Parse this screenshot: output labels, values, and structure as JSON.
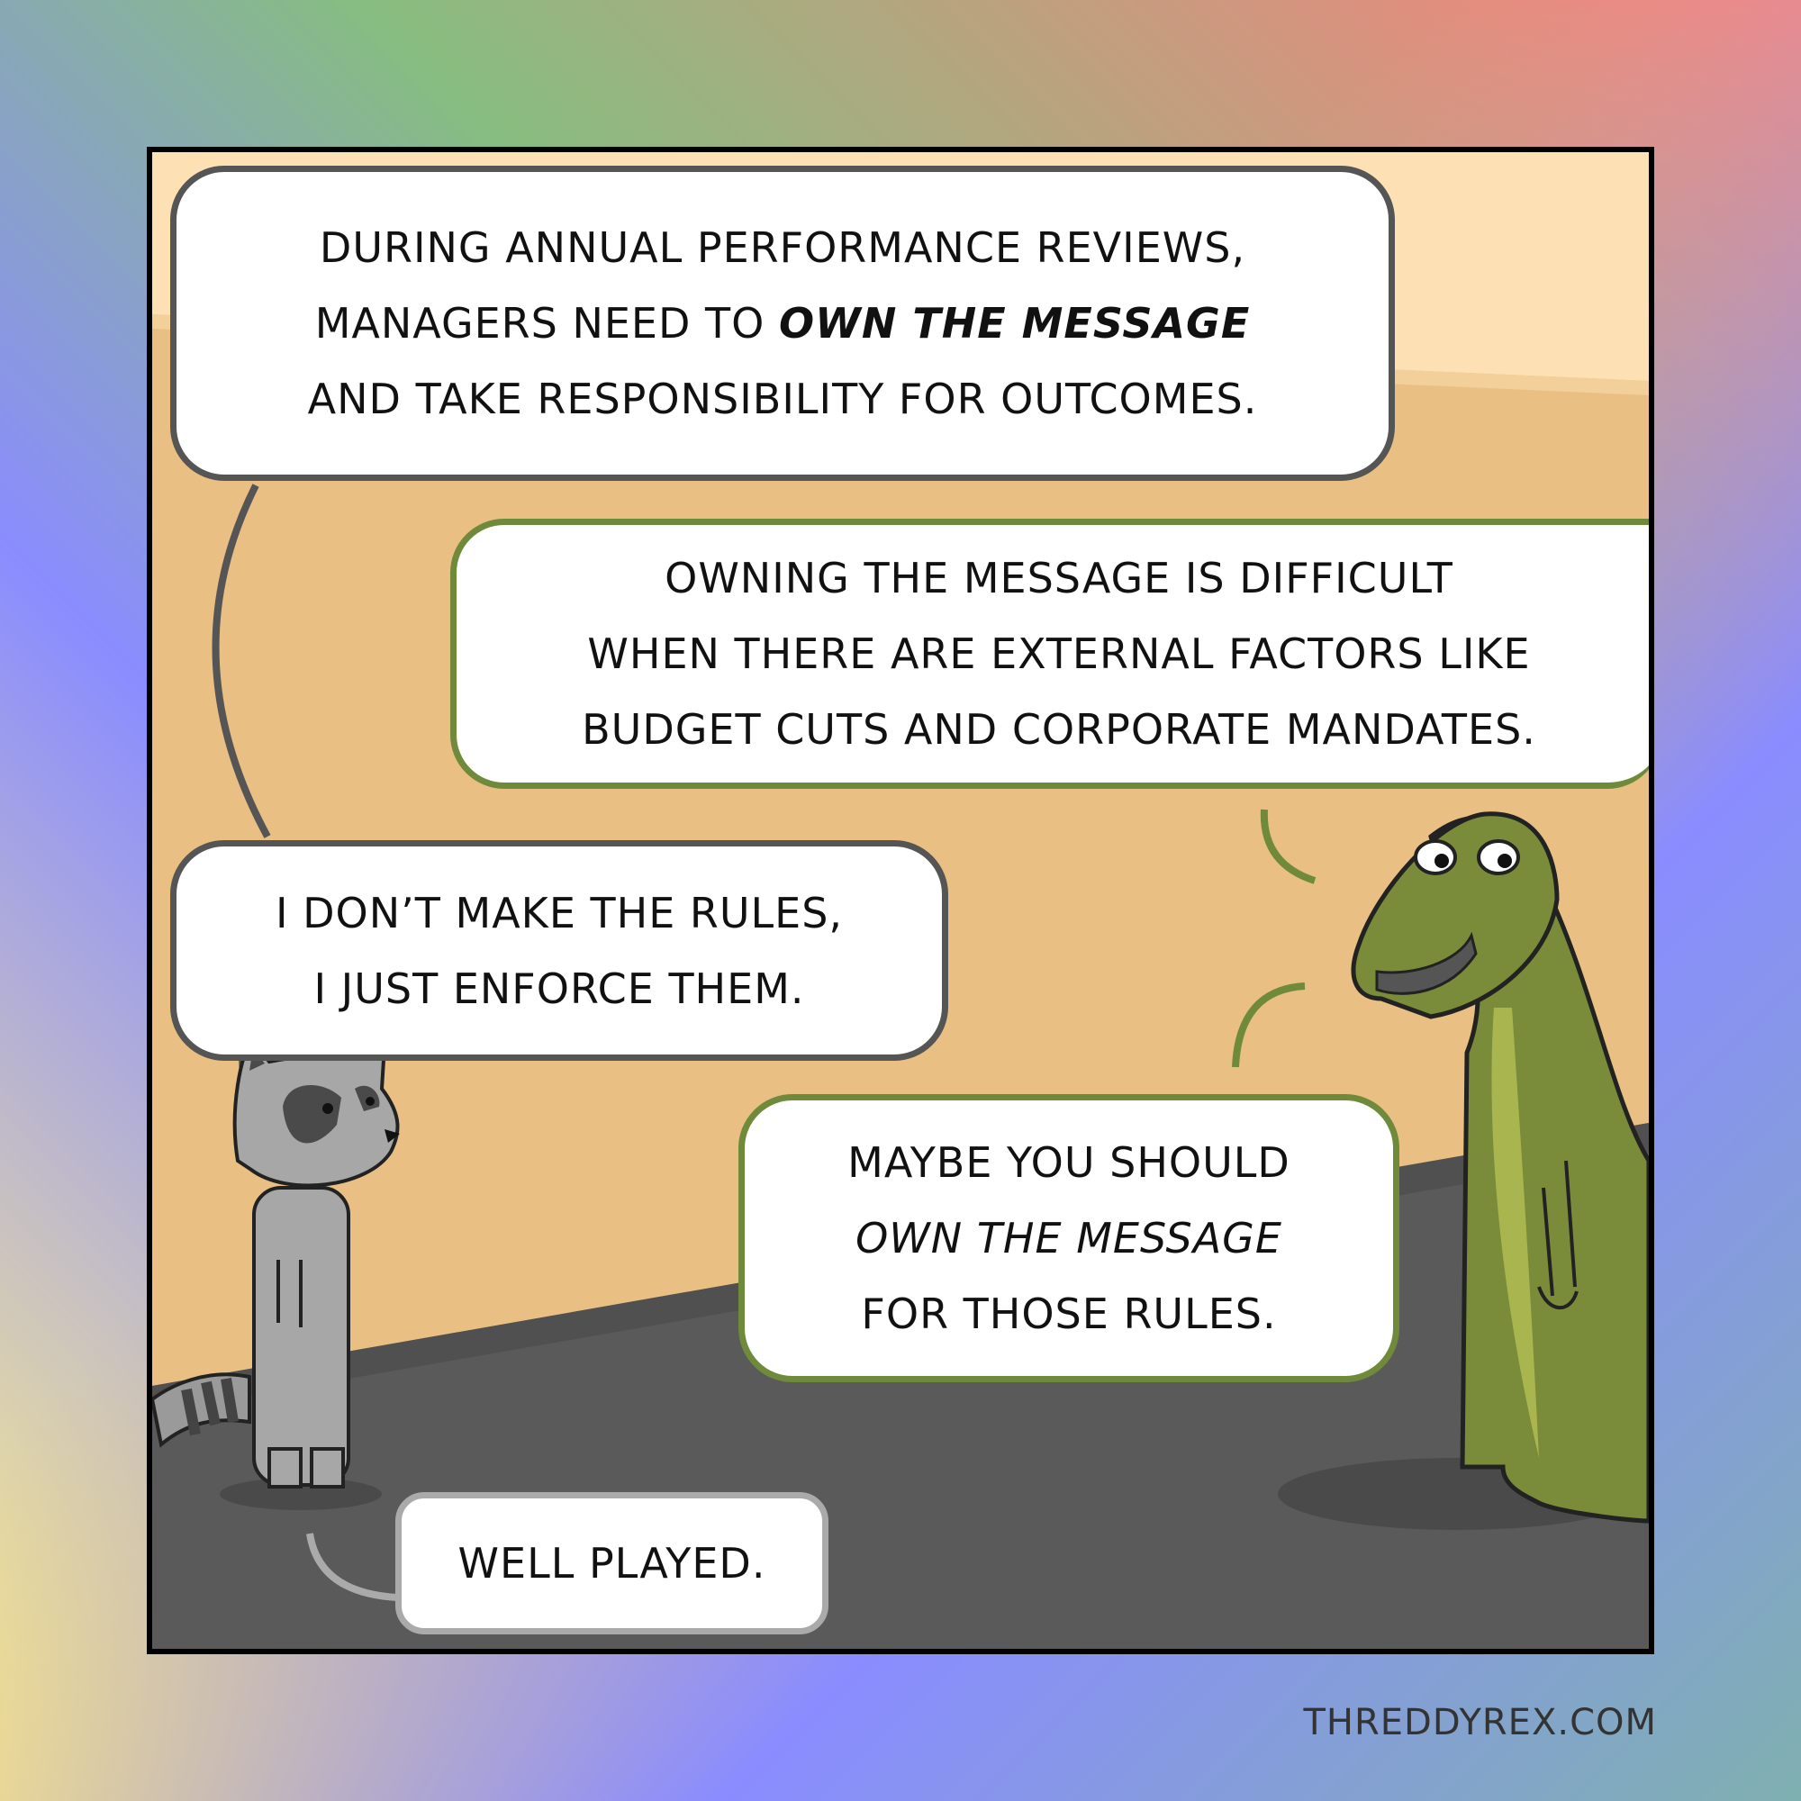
{
  "comic": {
    "bubbles": {
      "manager_line1": "DURING ANNUAL PERFORMANCE REVIEWS,",
      "manager_line2_a": "MANAGERS NEED TO ",
      "manager_line2_b": "OWN THE MESSAGE",
      "manager_line3": "AND TAKE RESPONSIBILITY FOR OUTCOMES.",
      "dino_line1": "OWNING THE MESSAGE IS DIFFICULT",
      "dino_line2": "WHEN THERE ARE EXTERNAL FACTORS LIKE",
      "dino_line3": "BUDGET CUTS AND CORPORATE MANDATES.",
      "raccoon_line1": "I DON’T MAKE THE RULES,",
      "raccoon_line2": "I JUST ENFORCE THEM.",
      "dino2_line1": "MAYBE YOU SHOULD",
      "dino2_line2": "OWN THE MESSAGE",
      "dino2_line3": "FOR THOSE RULES.",
      "raccoon2_line1": "WELL PLAYED."
    },
    "credit": "THREDDYREX.COM",
    "colors": {
      "wall": "#e9bf84",
      "wall_light": "#fde1b4",
      "floor": "#5a5a5a",
      "dino_green": "#7a8c3a",
      "dino_belly": "#a9b54f",
      "raccoon_grey": "#a7a7a7"
    }
  }
}
